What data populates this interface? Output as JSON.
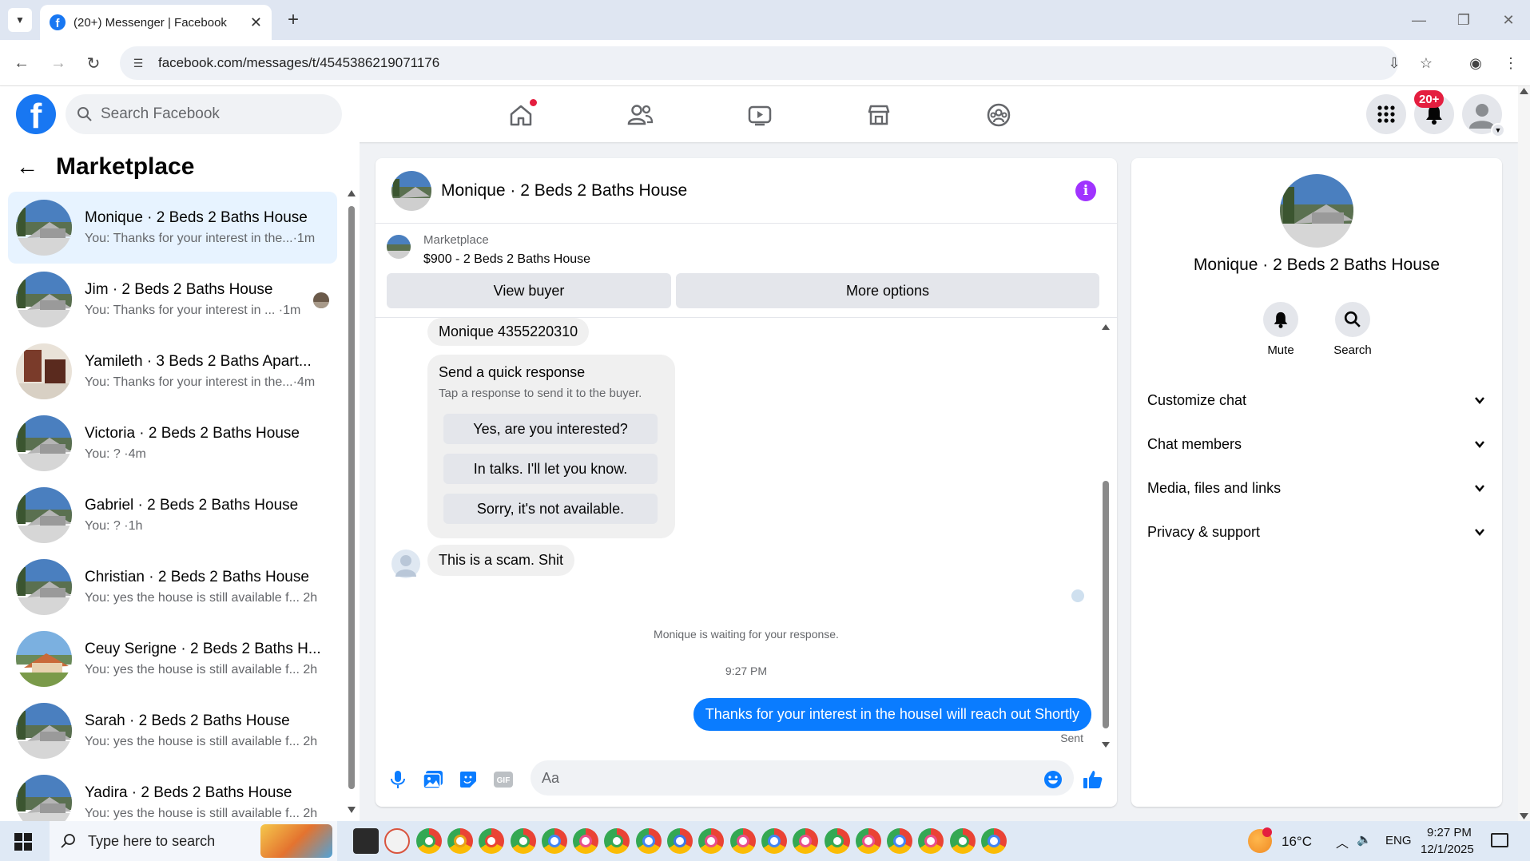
{
  "browser": {
    "tab_title": "(20+) Messenger | Facebook",
    "url": "facebook.com/messages/t/4545386219071176"
  },
  "header": {
    "search_placeholder": "Search Facebook",
    "notif_badge": "20+"
  },
  "left_panel": {
    "title": "Marketplace",
    "conversations": [
      {
        "name": "Monique · 2 Beds 2 Baths House",
        "preview": "You: Thanks for your interest in the...·1m",
        "active": true
      },
      {
        "name": "Jim · 2 Beds 2 Baths House",
        "preview": "You: Thanks for your interest in ... ·1m"
      },
      {
        "name": "Yamileth · 3 Beds 2 Baths Apart...",
        "preview": "You: Thanks for your interest in the...·4m"
      },
      {
        "name": "Victoria · 2 Beds 2 Baths House",
        "preview": "You: ? ·4m"
      },
      {
        "name": "Gabriel · 2 Beds 2 Baths House",
        "preview": "You: ? ·1h"
      },
      {
        "name": "Christian · 2 Beds 2 Baths House",
        "preview": "You: yes the house is still available f...  2h"
      },
      {
        "name": "Ceuy Serigne · 2 Beds 2 Baths H...",
        "preview": "You: yes the house is still available f...  2h"
      },
      {
        "name": "Sarah · 2 Beds 2 Baths House",
        "preview": "You: yes the house is still available f...  2h"
      },
      {
        "name": "Yadira · 2 Beds 2 Baths House",
        "preview": "You: yes the house is still available f...  2h"
      }
    ]
  },
  "chat": {
    "title": "Monique · 2 Beds 2 Baths House",
    "marketplace_label": "Marketplace",
    "listing": "$900 - 2 Beds 2 Baths House",
    "view_buyer": "View buyer",
    "more_options": "More options",
    "msg_contact": "Monique 4355220310",
    "quick_title": "Send a quick response",
    "quick_sub": "Tap a response to send it to the buyer.",
    "quick_1": "Yes, are you interested?",
    "quick_2": "In talks. I'll let you know.",
    "quick_3": "Sorry, it's not available.",
    "msg_scam": "This is a scam. Shit",
    "waiting": "Monique is waiting for your response.",
    "time": "9:27 PM",
    "sent_msg": "Thanks for your interest in the houseI will reach out Shortly",
    "sent_label": "Sent",
    "composer_placeholder": "Aa"
  },
  "right_panel": {
    "name": "Monique · 2 Beds 2 Baths House",
    "mute": "Mute",
    "search": "Search",
    "customize": "Customize chat",
    "members": "Chat members",
    "media": "Media, files and links",
    "privacy": "Privacy & support"
  },
  "taskbar": {
    "search_placeholder": "Type here to search",
    "temp": "16°C",
    "lang": "ENG",
    "time": "9:27 PM",
    "date": "12/1/2025"
  },
  "colors": {
    "fb_blue": "#1877f2",
    "messenger_blue": "#0a7cff",
    "active_row": "#e7f3ff",
    "notif_red": "#e41e3f"
  }
}
